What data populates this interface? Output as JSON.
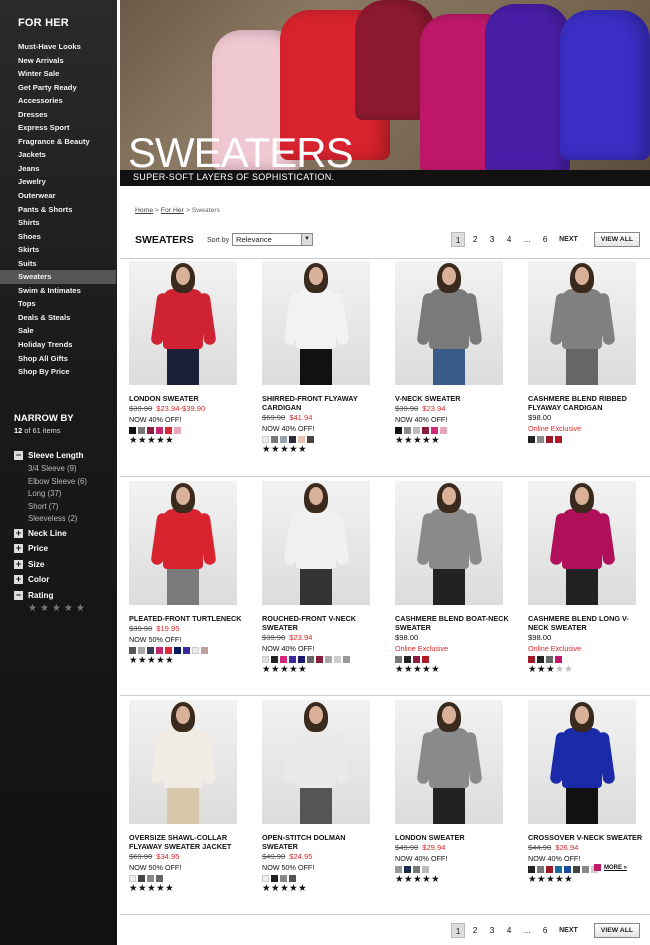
{
  "sidebar": {
    "title": "FOR HER",
    "nav": [
      "Must-Have Looks",
      "New Arrivals",
      "Winter Sale",
      "Get Party Ready",
      "Accessories",
      "Dresses",
      "Express Sport",
      "Fragrance & Beauty",
      "Jackets",
      "Jeans",
      "Jewelry",
      "Outerwear",
      "Pants & Shorts",
      "Shirts",
      "Shoes",
      "Skirts",
      "Suits",
      "Sweaters",
      "Swim & Intimates",
      "Tops",
      "Deals & Steals",
      "Sale",
      "Holiday Trends",
      "Shop All Gifts",
      "Shop By Price"
    ],
    "active": "Sweaters",
    "narrow_title": "NARROW BY",
    "count_shown": "12",
    "count_text": " of 61 items",
    "facets": [
      {
        "label": "Sleeve Length",
        "expanded": true,
        "options": [
          "3/4 Sleeve (9)",
          "Elbow Sleeve (6)",
          "Long (37)",
          "Short (7)",
          "Sleeveless (2)"
        ]
      },
      {
        "label": "Neck Line",
        "expanded": false
      },
      {
        "label": "Price",
        "expanded": false
      },
      {
        "label": "Size",
        "expanded": false
      },
      {
        "label": "Color",
        "expanded": false
      },
      {
        "label": "Rating",
        "expanded": true
      }
    ],
    "expand_symbol": "+",
    "collapse_symbol": "−"
  },
  "banner": {
    "title": "SWEATERS",
    "subtitle": "SUPER-SOFT LAYERS OF SOPHISTICATION.",
    "sweater_colors": [
      "#f0c8d2",
      "#d8232e",
      "#8e1a30",
      "#c0186b",
      "#4a1fa8",
      "#3a2ec4"
    ]
  },
  "breadcrumb": {
    "home": "Home",
    "sep": " > ",
    "for_her": "For Her",
    "current": "Sweaters"
  },
  "toolbar": {
    "title": "SWEATERS",
    "sort_label": "Sort by",
    "sort_value": "Relevance",
    "pages": [
      "1",
      "2",
      "3",
      "4",
      "...",
      "6"
    ],
    "current_page": "1",
    "next": "NEXT",
    "view_all": "VIEW ALL"
  },
  "products": [
    {
      "name": "LONDON SWEATER",
      "was": "$39.90",
      "now": "$23.94-$39.90",
      "promo": "NOW 40% OFF!",
      "colors": [
        "#111",
        "#777",
        "#8a1c3c",
        "#c02870",
        "#d82a3a",
        "#e8a7b8"
      ],
      "stars": 4.5,
      "outfit": "#cf2233",
      "pant": "#1b1f3a"
    },
    {
      "name": "SHIRRED-FRONT FLYAWAY CARDIGAN",
      "was": "$69.90",
      "now": "$41.94",
      "promo": "NOW 40% OFF!",
      "colors": [
        "#eee",
        "#777",
        "#9aa0b0",
        "#2a2a3a",
        "#e8c4b0",
        "#444"
      ],
      "stars": 5,
      "outfit": "#f2f2f2",
      "pant": "#111"
    },
    {
      "name": "V-NECK SWEATER",
      "was": "$39.90",
      "now": "$23.94",
      "promo": "NOW 40% OFF!",
      "colors": [
        "#111",
        "#8a8a8a",
        "#bdbdbd",
        "#8a1c3c",
        "#d02a78",
        "#e8a7b8"
      ],
      "stars": 4.5,
      "outfit": "#7a7a7a",
      "pant": "#3a5a8a"
    },
    {
      "name": "CASHMERE BLEND RIBBED FLYAWAY CARDIGAN",
      "was": "",
      "now": "",
      "reg": "$98.00",
      "promo": "Online Exclusive",
      "promo_red": true,
      "colors": [
        "#222",
        "#8a8a8a",
        "#9a1a2a",
        "#b01a2a"
      ],
      "stars": 0,
      "outfit": "#808080",
      "pant": "#666"
    },
    {
      "name": "PLEATED-FRONT TURTLENECK",
      "was": "$39.90",
      "now": "$19.95",
      "promo": "NOW 50% OFF!",
      "colors": [
        "#555",
        "#aaa",
        "#3a3a5a",
        "#c02870",
        "#d82a3a",
        "#0a1a60",
        "#3a2aa0",
        "#eee",
        "#bda0a0"
      ],
      "stars": 4.5,
      "outfit": "#d8232e",
      "pant": "#7a7a7a"
    },
    {
      "name": "ROUCHED-FRONT V-NECK SWEATER",
      "was": "$39.90",
      "now": "$23.94",
      "promo": "NOW 40% OFF!",
      "colors": [
        "#ddd",
        "#222",
        "#d02a78",
        "#3a2aa0",
        "#1a1a6a",
        "#666",
        "#8a1c3c",
        "#aaa",
        "#ccc",
        "#999"
      ],
      "stars": 4.5,
      "outfit": "#f0f0f0",
      "pant": "#333"
    },
    {
      "name": "CASHMERE BLEND BOAT-NECK SWEATER",
      "was": "",
      "now": "",
      "reg": "$98.00",
      "promo": "Online Exclusive",
      "promo_red": true,
      "colors": [
        "#777",
        "#222",
        "#8a1c3c",
        "#b01a2a"
      ],
      "stars": 4.5,
      "outfit": "#8a8a8a",
      "pant": "#222"
    },
    {
      "name": "CASHMERE BLEND LONG V-NECK SWEATER",
      "was": "",
      "now": "",
      "reg": "$98.00",
      "promo": "Online Exclusive",
      "promo_red": true,
      "colors": [
        "#9a1a2a",
        "#222",
        "#666",
        "#c0186b"
      ],
      "stars": 3,
      "outfit": "#b0105a",
      "pant": "#222"
    },
    {
      "name": "OVERSIZE SHAWL-COLLAR FLYAWAY SWEATER JACKET",
      "was": "$69.90",
      "now": "$34.95",
      "promo": "NOW 50% OFF!",
      "colors": [
        "#eee",
        "#444",
        "#888",
        "#666"
      ],
      "stars": 4.5,
      "outfit": "#f0ece4",
      "pant": "#d8c8aa"
    },
    {
      "name": "OPEN-STITCH DOLMAN SWEATER",
      "was": "$49.90",
      "now": "$24.95",
      "promo": "NOW 50% OFF!",
      "colors": [
        "#eee",
        "#222",
        "#888",
        "#555"
      ],
      "stars": 5,
      "outfit": "#eaeaea",
      "pant": "#555"
    },
    {
      "name": "LONDON SWEATER",
      "was": "$49.90",
      "now": "$29.94",
      "promo": "NOW 40% OFF!",
      "colors": [
        "#999",
        "#1a2a4a",
        "#777",
        "#bbb"
      ],
      "stars": 4.5,
      "outfit": "#8a8a8a",
      "pant": "#222"
    },
    {
      "name": "CROSSOVER V-NECK SWEATER",
      "was": "$44.90",
      "now": "$26.94",
      "promo": "NOW 40% OFF!",
      "colors": [
        "#222",
        "#777",
        "#9a1a2a",
        "#1a6a9a",
        "#1a4aa0",
        "#444",
        "#888",
        "#ccc"
      ],
      "stars": 4.5,
      "outfit": "#1a2aa8",
      "pant": "#111",
      "more": "MORE »",
      "more_color": "#c0186b"
    }
  ]
}
